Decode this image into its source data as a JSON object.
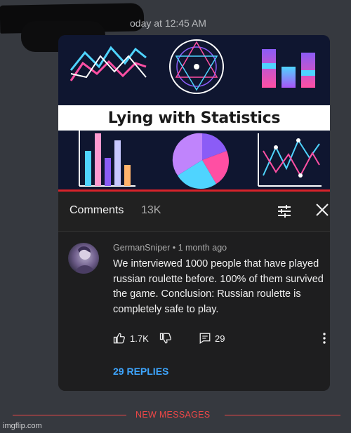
{
  "message": {
    "timestamp": "oday at 12:45 AM"
  },
  "video": {
    "title": "Lying with Statistics",
    "colors": {
      "background": "#0f1630",
      "pink": "#ff4fa3",
      "cyan": "#4fd4ff",
      "purple": "#8b5cf6",
      "violet": "#a855f7"
    }
  },
  "comments_panel": {
    "label": "Comments",
    "count": "13K",
    "sort_icon": "sort-sliders-icon",
    "close_icon": "close-icon"
  },
  "comment": {
    "meta": "GermanSniper • 1 month ago",
    "text": "We interviewed 1000 people that have played russian roulette before. 100% of them survived the game. Conclusion: Russian roulette is completely safe to play.",
    "likes": "1.7K",
    "replies_count": "29",
    "replies_link": "29 REPLIES"
  },
  "divider": {
    "label": "NEW MESSAGES",
    "color": "#f04747"
  },
  "watermark": "imgflip.com"
}
